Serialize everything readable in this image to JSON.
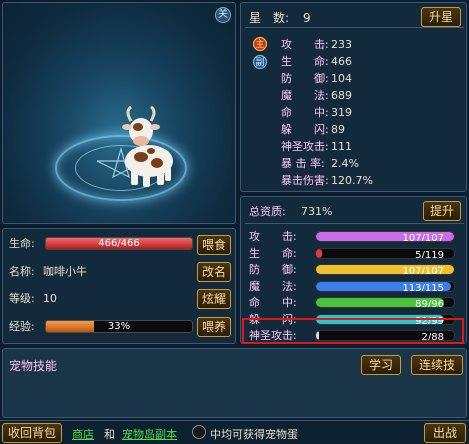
{
  "pet_view": {
    "close": "关"
  },
  "pet_info": {
    "hp_label": "生命:",
    "hp_text": "466/466",
    "hp_fraction": 1.0,
    "name_label": "名称:",
    "name_value": "咖啡小牛",
    "level_label": "等级:",
    "level_value": "10",
    "exp_label": "经验:",
    "exp_text": "33%",
    "exp_fraction": 0.33,
    "buttons": [
      "喂食",
      "改名",
      "炫耀",
      "喂养"
    ]
  },
  "stats": {
    "star_label": "星　数:",
    "star_value": "9",
    "upgrade_star_button": "升星",
    "main_badge": "主",
    "sub_badge": "副",
    "rows": [
      {
        "label": "攻　　击:",
        "value": "233"
      },
      {
        "label": "生　　命:",
        "value": "466"
      },
      {
        "label": "防　　御:",
        "value": "104"
      },
      {
        "label": "魔　　法:",
        "value": "689"
      },
      {
        "label": "命　　中:",
        "value": "319"
      },
      {
        "label": "躲　　闪:",
        "value": "89"
      },
      {
        "label": "神圣攻击:",
        "value": "111"
      },
      {
        "label": "暴 击 率:",
        "value": "2.4%"
      },
      {
        "label": "暴击伤害:",
        "value": "120.7%"
      }
    ]
  },
  "qualities": {
    "total_label": "总资质:",
    "total_value": "731%",
    "improve_button": "提升",
    "rows": [
      {
        "label": "攻　　击:",
        "text": "107/107",
        "fraction": 1.0,
        "color": "#c86de6"
      },
      {
        "label": "生　　命:",
        "text": "5/119",
        "fraction": 0.04,
        "color": "#e23b3b"
      },
      {
        "label": "防　　御:",
        "text": "107/107",
        "fraction": 1.0,
        "color": "#f0c12e"
      },
      {
        "label": "魔　　法:",
        "text": "113/115",
        "fraction": 0.98,
        "color": "#3a7ff0"
      },
      {
        "label": "命　　中:",
        "text": "89/96",
        "fraction": 0.93,
        "color": "#49c33a"
      },
      {
        "label": "躲　　闪:",
        "text": "92/99",
        "fraction": 0.93,
        "color": "#2bc6c6"
      },
      {
        "label": "神圣攻击:",
        "text": "2/88",
        "fraction": 0.02,
        "color": "#d8d8d8"
      }
    ]
  },
  "skills": {
    "title": "宠物技能",
    "learn_button": "学习",
    "combo_button": "连续技"
  },
  "bottom": {
    "back_button": "收回背包",
    "link1": "商店",
    "and_text": "和",
    "link2": "宠物岛副本",
    "tail_text": "中均可获得宠物蛋",
    "battle_button": "出战"
  }
}
